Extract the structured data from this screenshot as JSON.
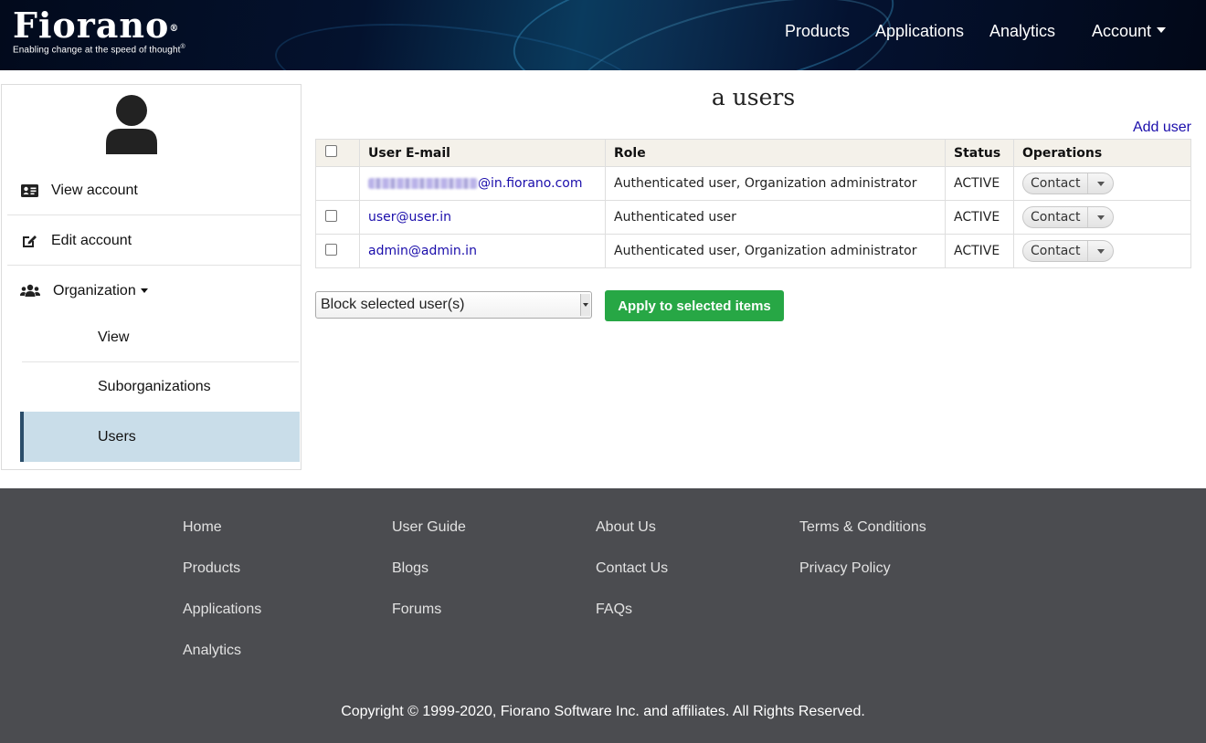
{
  "header": {
    "logo_text": "Fiorano",
    "logo_tagline": "Enabling change at the speed of thought",
    "nav": {
      "products": "Products",
      "applications": "Applications",
      "analytics": "Analytics",
      "account": "Account"
    }
  },
  "sidebar": {
    "view_account": "View account",
    "edit_account": "Edit account",
    "organization": "Organization",
    "sub_items": [
      "View",
      "Suborganizations",
      "Users"
    ],
    "active_sub_item": "Users"
  },
  "main": {
    "title": "a users",
    "add_user": "Add user",
    "table": {
      "headers": {
        "email": "User E-mail",
        "role": "Role",
        "status": "Status",
        "operations": "Operations"
      },
      "rows": [
        {
          "email_visible": "@in.fiorano.com",
          "role": "Authenticated user, Organization administrator",
          "status": "ACTIVE",
          "operation": "Contact"
        },
        {
          "email_visible": "user@user.in",
          "role": "Authenticated user",
          "status": "ACTIVE",
          "operation": "Contact"
        },
        {
          "email_visible": "admin@admin.in",
          "role": "Authenticated user, Organization administrator",
          "status": "ACTIVE",
          "operation": "Contact"
        }
      ]
    },
    "bulk_action": {
      "selected_option": "Block selected user(s)",
      "apply_label": "Apply to selected items"
    }
  },
  "footer": {
    "columns": [
      [
        "Home",
        "Products",
        "Applications",
        "Analytics"
      ],
      [
        "User Guide",
        "Blogs",
        "Forums"
      ],
      [
        "About Us",
        "Contact Us",
        "FAQs"
      ],
      [
        "Terms & Conditions",
        "Privacy Policy"
      ]
    ],
    "copyright": "Copyright © 1999-2020, Fiorano Software Inc. and affiliates. All Rights Reserved."
  },
  "colors": {
    "accent_green": "#27a745",
    "link_blue": "#1a0dab",
    "footer_bg": "#4b4c50",
    "active_item_bg": "#c9dde9"
  }
}
